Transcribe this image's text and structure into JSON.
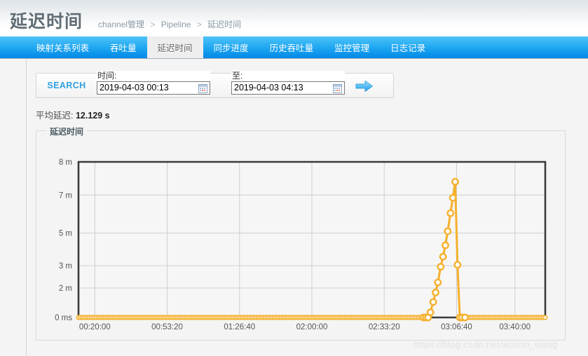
{
  "header": {
    "title": "延迟时间",
    "breadcrumb": [
      "channel管理",
      "Pipeline",
      "延迟时间"
    ],
    "separator": ">"
  },
  "tabs": [
    {
      "label": "映射关系列表",
      "active": false
    },
    {
      "label": "吞吐量",
      "active": false
    },
    {
      "label": "延迟时间",
      "active": true
    },
    {
      "label": "同步进度",
      "active": false
    },
    {
      "label": "历史吞吐量",
      "active": false
    },
    {
      "label": "监控管理",
      "active": false
    },
    {
      "label": "日志记录",
      "active": false
    }
  ],
  "search": {
    "button_label": "SEARCH",
    "from_label": "时间:",
    "from_value": "2019-04-03 00:13",
    "to_label": "至:",
    "to_value": "2019-04-03 04:13",
    "calendar_icon": "calendar-icon",
    "go_icon": "arrow-right-icon"
  },
  "summary": {
    "avg_label": "平均延迟:",
    "avg_value": "12.129 s"
  },
  "chart_panel": {
    "legend": "延迟时间"
  },
  "watermark": "https://blog.csdn.net/woson_wang",
  "colors": {
    "tab_bar_top": "#4ec3f7",
    "tab_bar_bottom": "#0089e8",
    "active_tab_bg": "#eeeeee",
    "series": "#f5b02e",
    "marker_fill": "#ffffff",
    "axis": "#3b3b3b",
    "grid": "#cfcfcf",
    "plot_bg": "#f6f6f6",
    "accent_link": "#2f9fe0"
  },
  "chart_data": {
    "type": "line",
    "title": "延迟时间",
    "xlabel": "",
    "ylabel": "",
    "grid": true,
    "legend_position": "none",
    "series_name": "延迟时间",
    "series_color": "#f5b02e",
    "marker": "circle",
    "ytick_labels": [
      "0 ms",
      "2 m",
      "3 m",
      "5 m",
      "7 m",
      "8 m"
    ],
    "ytick_values": [
      0,
      2,
      3,
      5,
      7,
      8
    ],
    "ytick_positions_frac": [
      0.0,
      0.189,
      0.333,
      0.542,
      0.787,
      1.0
    ],
    "ylim": [
      0,
      8
    ],
    "yunit": "minutes",
    "xtick_labels": [
      "00:20:00",
      "00:53:20",
      "01:26:40",
      "02:00:00",
      "02:33:20",
      "03:06:40",
      "03:40:00"
    ],
    "xtick_positions_frac": [
      0.035,
      0.19,
      0.345,
      0.5,
      0.655,
      0.81,
      0.935
    ],
    "xlim_labels": [
      "00:13:00",
      "04:13:00"
    ],
    "baseline_value": 0,
    "note": "Flat near-zero baseline across the full range except one narrow spike just before 03:06:40.",
    "points": [
      {
        "x_frac": 0.739,
        "y": 0.0
      },
      {
        "x_frac": 0.744,
        "y": 0.0
      },
      {
        "x_frac": 0.749,
        "y": 0.0
      },
      {
        "x_frac": 0.754,
        "y": 0.35
      },
      {
        "x_frac": 0.76,
        "y": 1.05
      },
      {
        "x_frac": 0.765,
        "y": 1.7
      },
      {
        "x_frac": 0.77,
        "y": 2.25
      },
      {
        "x_frac": 0.776,
        "y": 2.95
      },
      {
        "x_frac": 0.781,
        "y": 3.55
      },
      {
        "x_frac": 0.786,
        "y": 4.25
      },
      {
        "x_frac": 0.791,
        "y": 5.1
      },
      {
        "x_frac": 0.797,
        "y": 6.05
      },
      {
        "x_frac": 0.802,
        "y": 6.85
      },
      {
        "x_frac": 0.807,
        "y": 7.4
      },
      {
        "x_frac": 0.812,
        "y": 3.05
      },
      {
        "x_frac": 0.817,
        "y": 0.0
      },
      {
        "x_frac": 0.822,
        "y": 0.0
      },
      {
        "x_frac": 0.828,
        "y": 0.0
      }
    ]
  }
}
